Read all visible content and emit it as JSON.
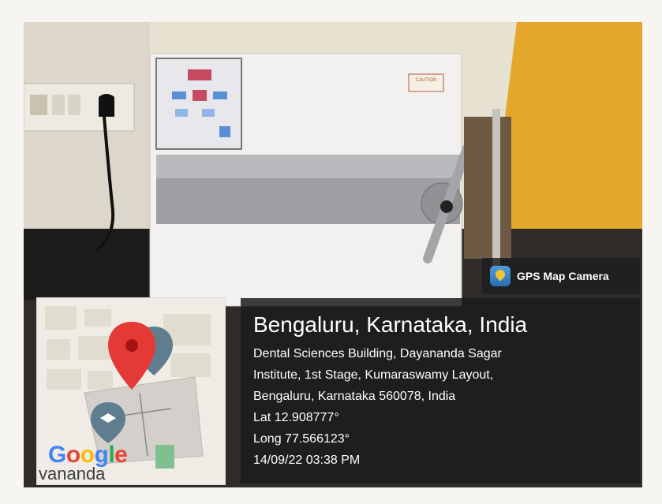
{
  "badge": {
    "icon": "gps-map-camera-icon",
    "label": "GPS Map Camera"
  },
  "map": {
    "logo_letters": [
      {
        "ch": "G",
        "color": "#4285f4"
      },
      {
        "ch": "o",
        "color": "#ea4335"
      },
      {
        "ch": "o",
        "color": "#fbbc05"
      },
      {
        "ch": "g",
        "color": "#4285f4"
      },
      {
        "ch": "l",
        "color": "#34a853"
      },
      {
        "ch": "e",
        "color": "#ea4335"
      }
    ],
    "place_text": "vananda"
  },
  "location": {
    "title": "Bengaluru, Karnataka, India",
    "address_lines": [
      "Dental Sciences Building, Dayananda Sagar",
      "Institute, 1st Stage, Kumaraswamy Layout,",
      "Bengaluru, Karnataka 560078, India"
    ],
    "lat": "Lat 12.908777°",
    "long": "Long 77.566123°",
    "datetime": "14/09/22 03:38 PM"
  },
  "photo_sign": "CAUTION"
}
